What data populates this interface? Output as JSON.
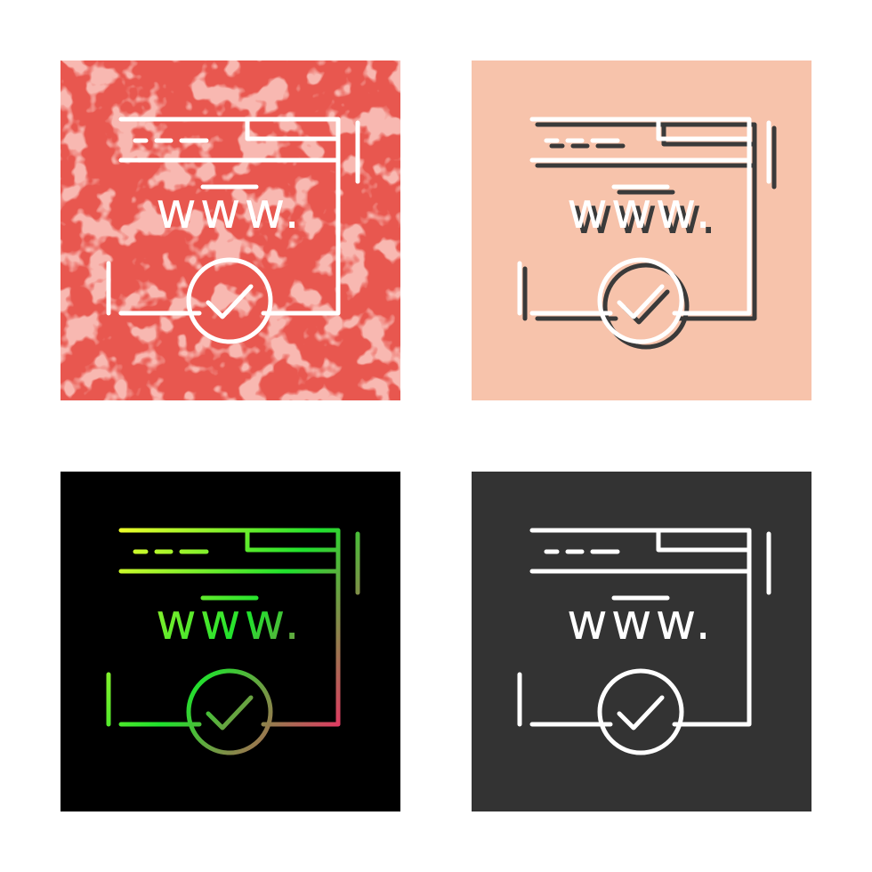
{
  "label": "www.",
  "colors": {
    "page_bg": "#ffffff",
    "tile_red": "#e8574f",
    "tile_red_texture": "#f07a6f",
    "tile_peach": "#f7c3ab",
    "tile_black": "#000000",
    "tile_dark": "#333333",
    "line_white": "#ffffff",
    "line_shadow": "#3a3a3a",
    "gradient_start": "#f5ff2a",
    "gradient_mid": "#1fe22d",
    "gradient_end": "#ff1f6b"
  },
  "tiles": [
    {
      "style": "glyph-textured",
      "background": "#e8574f",
      "stroke": "#ffffff"
    },
    {
      "style": "line-with-shadow",
      "background": "#f7c3ab",
      "stroke": "#ffffff"
    },
    {
      "style": "gradient-line",
      "background": "#000000",
      "stroke": "gradient"
    },
    {
      "style": "line",
      "background": "#333333",
      "stroke": "#ffffff"
    }
  ]
}
